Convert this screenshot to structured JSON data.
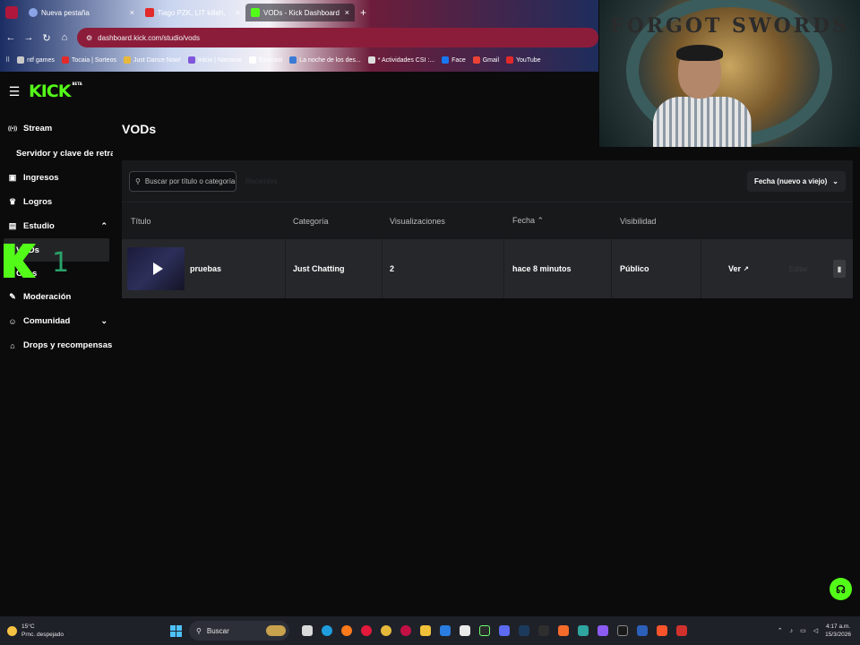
{
  "browser": {
    "tabs": [
      {
        "label": "Nueva pestaña",
        "favicon_color": "#8aa4e6"
      },
      {
        "label": "Tiago PZK, LIT killah, ...",
        "favicon_color": "#e22a2a"
      },
      {
        "label": "VODs - Kick Dashboard",
        "favicon_color": "#53fc18"
      }
    ],
    "new_tab": "+",
    "url": "dashboard.kick.com/studio/vods",
    "bookmarks": [
      "ntf games",
      "Tocaia | Sorteos",
      "Just Dance Now!",
      "Inicio | Narrame",
      "Ezwcast",
      "La noche de los des...",
      "* Actividades CSI :...",
      "Face",
      "Gmail",
      "YouTube"
    ]
  },
  "webcam": {
    "overlay_text": "FORGOT  SWORDS"
  },
  "header": {
    "logo": "KICK",
    "logo_badge": "BETA"
  },
  "sidebar": {
    "items": [
      {
        "label": "Stream",
        "icon": "broadcast-icon",
        "glyph": "((•))"
      },
      {
        "label": "Servidor y clave de retransmisión",
        "sub": true
      },
      {
        "label": "Ingresos",
        "icon": "wallet-icon",
        "glyph": "▣"
      },
      {
        "label": "Logros",
        "icon": "trophy-icon",
        "glyph": "♛"
      },
      {
        "label": "Estudio",
        "icon": "studio-icon",
        "glyph": "▤",
        "chevron": "⌃"
      },
      {
        "label": "VODs",
        "sub": true,
        "selected": true
      },
      {
        "label": "Clips",
        "sub": true
      },
      {
        "label": "Moderación",
        "icon": "wrench-icon",
        "glyph": "✎"
      },
      {
        "label": "Comunidad",
        "icon": "community-icon",
        "glyph": "☺",
        "chevron": "⌄"
      },
      {
        "label": "Drops y recompensas",
        "icon": "gift-icon",
        "glyph": "⌂"
      }
    ],
    "overlay_number": "1"
  },
  "main": {
    "title": "VODs",
    "search_placeholder": "Buscar por título o categoría",
    "ghost_label": "Recientes",
    "sort_label": "Fecha (nuevo a viejo)",
    "columns": {
      "title": "Título",
      "category": "Categoría",
      "views": "Visualizaciones",
      "date": "Fecha",
      "visibility": "Visibilidad"
    },
    "rows": [
      {
        "title": "pruebas",
        "category": "Just Chatting",
        "views": "2",
        "date": "hace 8 minutos",
        "visibility": "Público",
        "view_action": "Ver",
        "edit_action": "Editar"
      }
    ]
  },
  "taskbar": {
    "weather_temp": "15°C",
    "weather_desc": "Prnc. despejado",
    "search_label": "Buscar",
    "time": "4:17 a.m.",
    "date": "15/3/2026"
  },
  "colors": {
    "accent": "#53fc18",
    "background": "#0b0b0c",
    "panel": "#18191b",
    "row": "#26272a"
  }
}
